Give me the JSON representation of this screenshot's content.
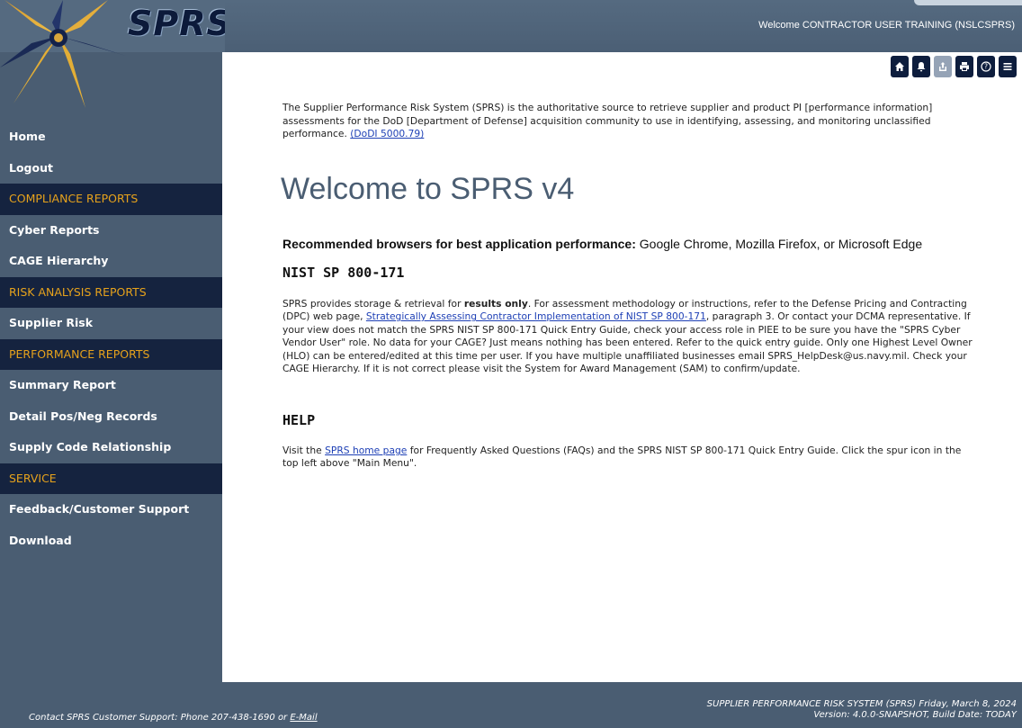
{
  "header": {
    "logo_text": "SPRS",
    "welcome_text": "Welcome CONTRACTOR USER TRAINING (NSLCSPRS)"
  },
  "toolbar": {
    "buttons": [
      {
        "icon": "home-icon"
      },
      {
        "icon": "bell-icon"
      },
      {
        "icon": "share-icon",
        "disabled": true
      },
      {
        "icon": "print-icon"
      },
      {
        "icon": "help-icon"
      },
      {
        "icon": "menu-icon"
      }
    ]
  },
  "sidebar": {
    "home": "Home",
    "logout": "Logout",
    "compliance_reports": "COMPLIANCE REPORTS",
    "cyber_reports": "Cyber Reports",
    "cage_hierarchy": "CAGE Hierarchy",
    "risk_analysis_reports": "RISK ANALYSIS REPORTS",
    "supplier_risk": "Supplier Risk",
    "performance_reports": "PERFORMANCE REPORTS",
    "summary_report": "Summary Report",
    "detail_records": "Detail Pos/Neg Records",
    "supply_code": "Supply Code Relationship",
    "service": "SERVICE",
    "feedback": "Feedback/Customer Support",
    "download": "Download"
  },
  "main": {
    "intro_text": "The Supplier Performance Risk System (SPRS) is the authoritative source to retrieve supplier and product PI [performance information] assessments for the DoD [Department of Defense] acquisition community to use in identifying, assessing, and monitoring unclassified performance.",
    "intro_link": "(DoDI 5000.79)",
    "title": "Welcome to SPRS v4",
    "browsers_label": "Recommended browsers for best application performance:",
    "browsers_list": "Google Chrome, Mozilla Firefox, or Microsoft Edge",
    "nist_heading": "NIST SP 800-171",
    "nist_p1": "SPRS provides storage & retrieval for",
    "nist_bold": "results only",
    "nist_p2": ". For assessment methodology or instructions, refer to the Defense Pricing and Contracting (DPC) web page,",
    "nist_link": "Strategically Assessing Contractor Implementation of NIST SP 800-171",
    "nist_p3": ", paragraph 3. Or contact your DCMA representative. If your view does not match the SPRS NIST SP 800-171 Quick Entry Guide, check your access role in PIEE to be sure you have the \"SPRS Cyber Vendor User\" role. No data for your CAGE? Just means nothing has been entered. Refer to the quick entry guide. Only one Highest Level Owner (HLO) can be entered/edited at this time per user. If you have multiple unaffiliated businesses email SPRS_HelpDesk@us.navy.mil. Check your CAGE Hierarchy. If it is not correct please visit the System for Award Management (SAM) to confirm/update.",
    "help_heading": "HELP",
    "help_p1": "Visit the",
    "help_link": "SPRS home page",
    "help_p2": "for Frequently Asked Questions (FAQs) and the SPRS NIST SP 800-171 Quick Entry Guide. Click the spur icon in the top left above \"Main Menu\"."
  },
  "footer": {
    "contact_text": "Contact SPRS Customer Support: Phone 207-438-1690 or",
    "email_link": "E-Mail",
    "system_line": "SUPPLIER PERFORMANCE RISK SYSTEM (SPRS)  Friday, March 8, 2024",
    "version_line": "Version: 4.0.0-SNAPSHOT, Build Date: TODAY"
  },
  "colors": {
    "brand": "#4a5d72",
    "section_bg": "#15233f",
    "section_text": "#e6a21c",
    "link": "#1d3fb5"
  }
}
